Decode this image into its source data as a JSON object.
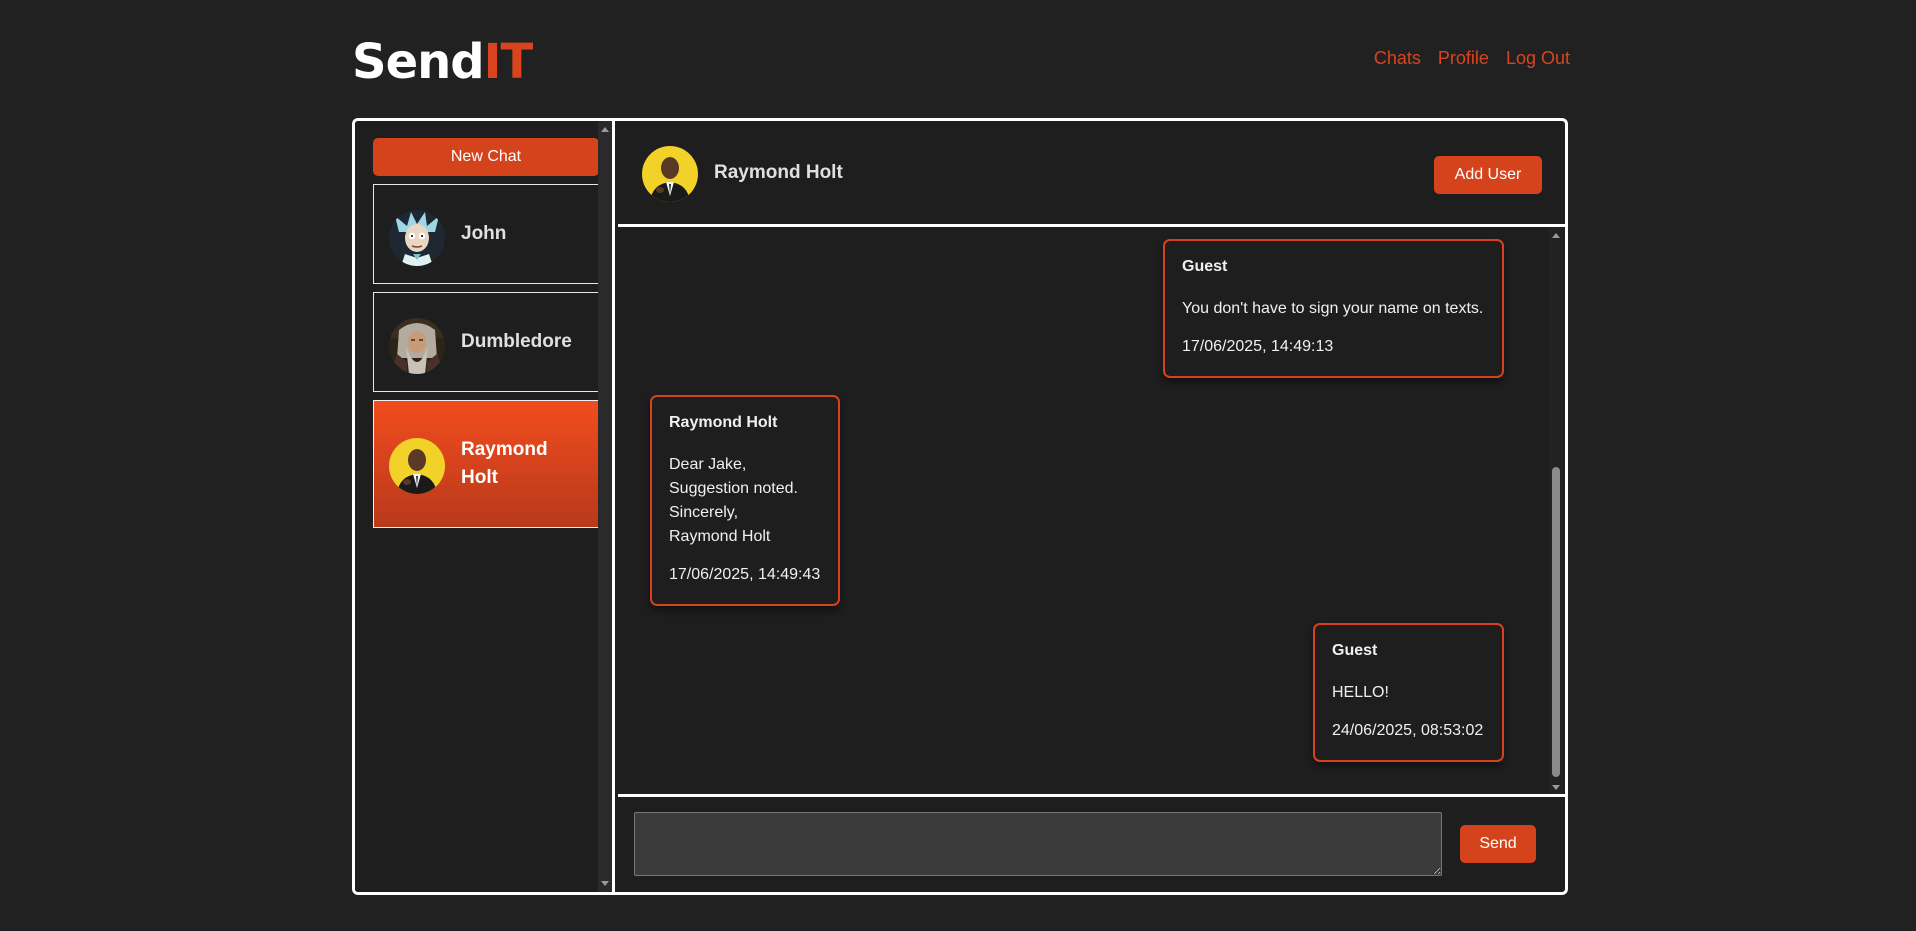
{
  "header": {
    "logo_primary": "Send",
    "logo_accent": "IT",
    "nav": {
      "chats": "Chats",
      "profile": "Profile",
      "logout": "Log Out"
    }
  },
  "sidebar": {
    "new_chat_label": "New Chat",
    "contacts": [
      {
        "name": "John",
        "avatar_icon": "rick-avatar"
      },
      {
        "name": "Dumbledore",
        "avatar_icon": "dumbledore-avatar"
      },
      {
        "name": "Raymond Holt",
        "avatar_icon": "raymond-holt-avatar",
        "active": true
      }
    ]
  },
  "chat": {
    "title": "Raymond Holt",
    "add_user_label": "Add User",
    "messages": [
      {
        "sender": "Guest",
        "text": "You don't have to sign your name on texts.",
        "time": "17/06/2025, 14:49:13",
        "outgoing": true
      },
      {
        "sender": "Raymond Holt",
        "text": "Dear Jake,\nSuggestion noted.\nSincerely,\nRaymond Holt",
        "time": "17/06/2025, 14:49:43",
        "outgoing": false
      },
      {
        "sender": "Guest",
        "text": "HELLO!",
        "time": "24/06/2025, 08:53:02",
        "outgoing": true
      }
    ],
    "composer": {
      "value": "",
      "send_label": "Send"
    }
  },
  "colors": {
    "accent": "#d5431c",
    "background": "#212121",
    "panel": "#1e1e1e",
    "border": "#ffffff"
  }
}
